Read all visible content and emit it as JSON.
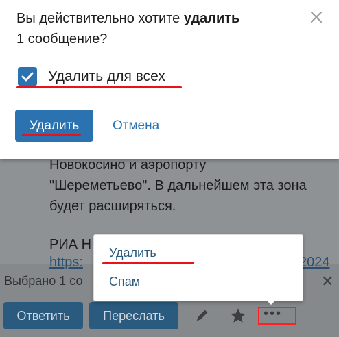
{
  "dialog": {
    "question_part1": "Вы действительно хотите ",
    "question_bold": "удалить",
    "question_line2": "1 сообщение?",
    "checkbox_label": "Удалить для всех",
    "checkbox_checked": true,
    "delete_button": "Удалить",
    "cancel_button": "Отмена"
  },
  "background": {
    "text_lines": [
      "Новокосино и аэропорту",
      "\"Шереметьево\". В дальнейшем эта зона",
      "будет расширяться."
    ],
    "ria_text": "РИА Н",
    "link_left": "https:",
    "link_right": "2024"
  },
  "selection_bar": {
    "label": "Выбрано 1 со",
    "reply_button": "Ответить",
    "forward_button": "Переслать"
  },
  "menu": {
    "items": [
      "Удалить",
      "Спам"
    ]
  },
  "colors": {
    "accent": "#2b73b0",
    "highlight_red": "#e8121a",
    "overlay": "#8f9294"
  },
  "icons": {
    "close": "close-icon",
    "check": "checkmark-icon",
    "edit": "pencil-icon",
    "favorite": "star-icon",
    "more": "more-dots-icon"
  }
}
